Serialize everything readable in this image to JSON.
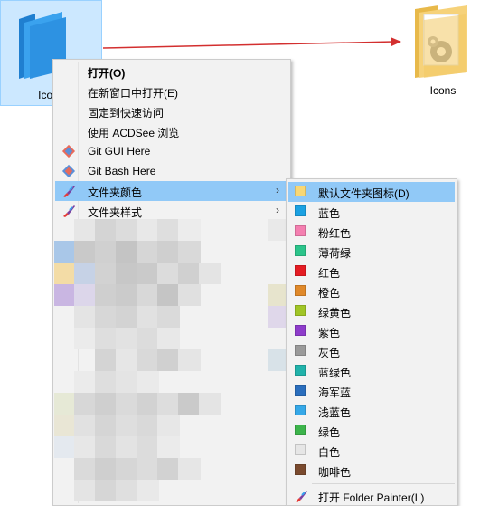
{
  "desktop": {
    "selected_folder_label": "Icons",
    "target_folder_label": "Icons"
  },
  "colors": {
    "menu_bg": "#f2f2f2",
    "highlight": "#91c9f7",
    "selection": "#cce8ff",
    "arrow": "#d32f2f"
  },
  "main_menu": {
    "items": [
      {
        "label": "打开(O)",
        "bold": true
      },
      {
        "label": "在新窗口中打开(E)"
      },
      {
        "label": "固定到快速访问"
      },
      {
        "label": "使用 ACDSee 浏览"
      },
      {
        "label": "Git GUI Here",
        "icon": "git-gui-icon"
      },
      {
        "label": "Git Bash Here",
        "icon": "git-bash-icon"
      },
      {
        "label": "文件夹颜色",
        "icon": "paintbrush-icon",
        "submenu": true,
        "highlighted": true
      },
      {
        "label": "文件夹样式",
        "icon": "paintbrush-icon",
        "submenu": true
      }
    ]
  },
  "sub_menu": {
    "items": [
      {
        "label": "默认文件夹图标(D)",
        "color": "#f8d775",
        "highlighted": true
      },
      {
        "label": "蓝色",
        "color": "#1ba1e2"
      },
      {
        "label": "粉红色",
        "color": "#f47fb0"
      },
      {
        "label": "薄荷绿",
        "color": "#2bc48a"
      },
      {
        "label": "红色",
        "color": "#e51c23"
      },
      {
        "label": "橙色",
        "color": "#e0892a"
      },
      {
        "label": "绿黄色",
        "color": "#a0c526"
      },
      {
        "label": "紫色",
        "color": "#8e3ccb"
      },
      {
        "label": "灰色",
        "color": "#9a9a9a"
      },
      {
        "label": "蓝绿色",
        "color": "#20b2aa"
      },
      {
        "label": "海军蓝",
        "color": "#2a6ebd"
      },
      {
        "label": "浅蓝色",
        "color": "#35a8e8"
      },
      {
        "label": "绿色",
        "color": "#3cb44b"
      },
      {
        "label": "白色",
        "color": "#e6e6e6"
      },
      {
        "label": "咖啡色",
        "color": "#7a4a2e"
      }
    ],
    "footer": {
      "label": "打开 Folder Painter(L)",
      "icon": "paintbrush-icon"
    }
  }
}
